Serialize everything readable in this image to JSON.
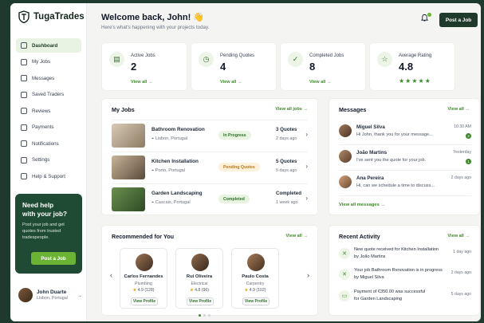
{
  "brand": {
    "name": "TugaTrades"
  },
  "sidebar": {
    "items": [
      {
        "label": "Dashboard",
        "icon": "home-icon"
      },
      {
        "label": "My Jobs",
        "icon": "briefcase-icon"
      },
      {
        "label": "Messages",
        "icon": "chat-icon"
      },
      {
        "label": "Saved Traders",
        "icon": "bookmark-icon"
      },
      {
        "label": "Reviews",
        "icon": "star-icon"
      },
      {
        "label": "Payments",
        "icon": "card-icon"
      },
      {
        "label": "Notifications",
        "icon": "bell-icon"
      },
      {
        "label": "Settings",
        "icon": "gear-icon"
      },
      {
        "label": "Help & Support",
        "icon": "help-icon"
      }
    ],
    "help": {
      "title_line1": "Need help",
      "title_line2": "with your job?",
      "text": "Post your job and get quotes from trusted tradespeople.",
      "button": "Post a Job"
    },
    "user": {
      "name": "John Duarte",
      "location": "Lisbon, Portugal"
    }
  },
  "header": {
    "welcome": "Welcome back, John! 👋",
    "subtitle": "Here's what's happening with your projects today.",
    "post_button": "Post a Job"
  },
  "stats": [
    {
      "label": "Active Jobs",
      "value": "2",
      "link": "View all →",
      "icon": "clipboard-icon"
    },
    {
      "label": "Pending Quotes",
      "value": "4",
      "link": "View all →",
      "icon": "clock-icon"
    },
    {
      "label": "Completed Jobs",
      "value": "8",
      "link": "View all →",
      "icon": "check-icon"
    },
    {
      "label": "Average Rating",
      "value": "4.8",
      "icon": "star-icon",
      "stars": "★★★★★"
    }
  ],
  "my_jobs": {
    "title": "My Jobs",
    "link": "View all jobs →",
    "rows": [
      {
        "title": "Bathroom Renovation",
        "location": "Lisbon, Portugal",
        "status": "In Progress",
        "quotes": "3 Quotes",
        "age": "2 days ago"
      },
      {
        "title": "Kitchen Installation",
        "location": "Porto, Portugal",
        "status": "Pending Quotes",
        "quotes": "5 Quotes",
        "age": "5 days ago"
      },
      {
        "title": "Garden Landscaping",
        "location": "Cascais, Portugal",
        "status": "Completed",
        "quotes": "Completed",
        "age": "1 week ago"
      }
    ]
  },
  "messages": {
    "title": "Messages",
    "link": "View all →",
    "items": [
      {
        "name": "Miguel Silva",
        "text": "Hi John, thank you for your message...",
        "time": "10:30 AM",
        "unread": "2"
      },
      {
        "name": "João Martins",
        "text": "I've sent you the quote for your job.",
        "time": "Yesterday",
        "unread": "1"
      },
      {
        "name": "Ana Pereira",
        "text": "Hi, can we schedule a time to discuss...",
        "time": "2 days ago",
        "unread": ""
      }
    ],
    "footer": "View all messages →"
  },
  "recommended": {
    "title": "Recommended for You",
    "link": "View all →",
    "traders": [
      {
        "name": "Carlos Fernandes",
        "trade": "Plumbing",
        "rating": "4.9 (128)",
        "button": "View Profile"
      },
      {
        "name": "Rui Oliveira",
        "trade": "Electrical",
        "rating": "4.8 (96)",
        "button": "View Profile"
      },
      {
        "name": "Paulo Costa",
        "trade": "Carpentry",
        "rating": "4.9 (102)",
        "button": "View Profile"
      }
    ]
  },
  "activity": {
    "title": "Recent Activity",
    "link": "View all →",
    "items": [
      {
        "line1": "New quote received for Kitchen Installation",
        "line2": "by João Martins",
        "time": "1 day ago"
      },
      {
        "line1": "Your job Bathroom Renovation is in progress",
        "line2": "by Miguel Silva",
        "time": "2 days ago"
      },
      {
        "line1": "Payment of €350.00 was successful",
        "line2": "for Garden Landscaping",
        "time": "5 days ago"
      }
    ]
  },
  "colors": {
    "brand_dark": "#1f3a2a",
    "accent": "#6ab334",
    "link": "#3f8a2a"
  }
}
